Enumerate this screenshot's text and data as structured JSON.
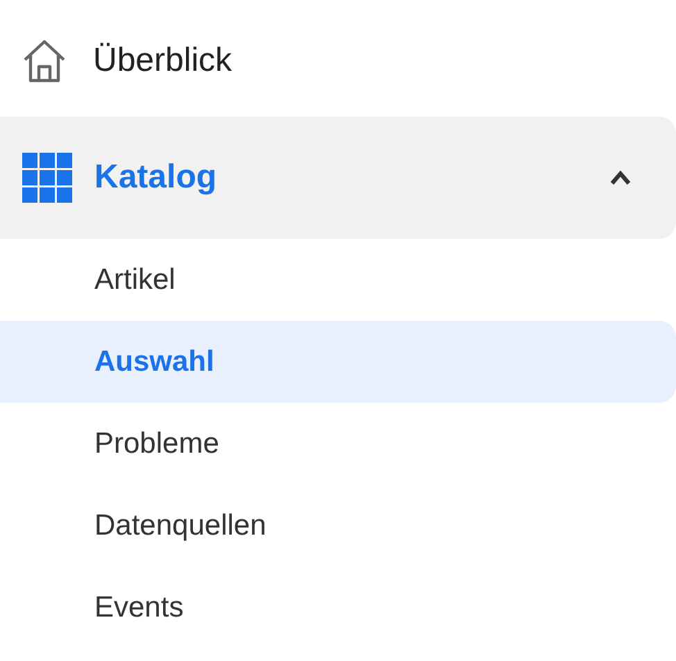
{
  "nav": [
    {
      "label": "Überblick",
      "kind": "link",
      "selected": false
    },
    {
      "label": "Katalog",
      "kind": "group",
      "selected": true,
      "expanded": true,
      "children": [
        {
          "label": "Artikel",
          "selected": false
        },
        {
          "label": "Auswahl",
          "selected": true
        },
        {
          "label": "Probleme",
          "selected": false
        },
        {
          "label": "Datenquellen",
          "selected": false
        },
        {
          "label": "Events",
          "selected": false
        }
      ]
    }
  ]
}
